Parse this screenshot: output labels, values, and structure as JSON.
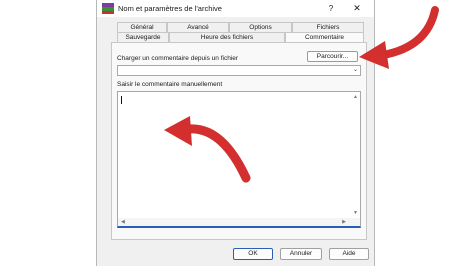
{
  "window": {
    "title": "Nom et paramètres de l'archive",
    "help_label": "?",
    "close_label": "✕"
  },
  "tabs": {
    "row1": [
      {
        "label": "Général"
      },
      {
        "label": "Avancé"
      },
      {
        "label": "Options"
      },
      {
        "label": "Fichiers"
      }
    ],
    "row2": [
      {
        "label": "Sauvegarde"
      },
      {
        "label": "Heure des fichiers"
      },
      {
        "label": "Commentaire",
        "active": true
      }
    ]
  },
  "comment": {
    "load_label": "Charger un commentaire depuis un fichier",
    "browse_label": "Parcourir...",
    "file_path": "",
    "manual_label": "Saisir le commentaire manuellement",
    "text": ""
  },
  "buttons": {
    "ok": "OK",
    "cancel": "Annuler",
    "help": "Aide"
  },
  "colors": {
    "annotation_arrow": "#d32f2f",
    "focus_border": "#2b5fb3"
  }
}
